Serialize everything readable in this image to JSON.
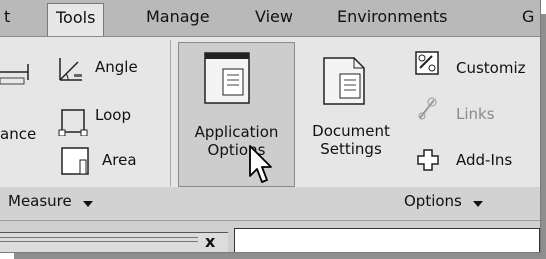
{
  "tabs": [
    "t",
    "Tools",
    "Manage",
    "View",
    "Environments",
    "G"
  ],
  "measure_panel": {
    "partial_label": "ance",
    "angle": "Angle",
    "loop": "Loop",
    "area": "Area",
    "title": "Measure",
    "dropdown_icon": "caret-down-icon"
  },
  "options_panel": {
    "application_options": [
      "Application",
      "Options"
    ],
    "document_settings": [
      "Document",
      "Settings"
    ],
    "customize": "Customiz",
    "links": "Links",
    "add_ins": "Add-Ins",
    "title": "Options",
    "dropdown_icon": "caret-down-icon"
  },
  "document_tab_close": "x"
}
